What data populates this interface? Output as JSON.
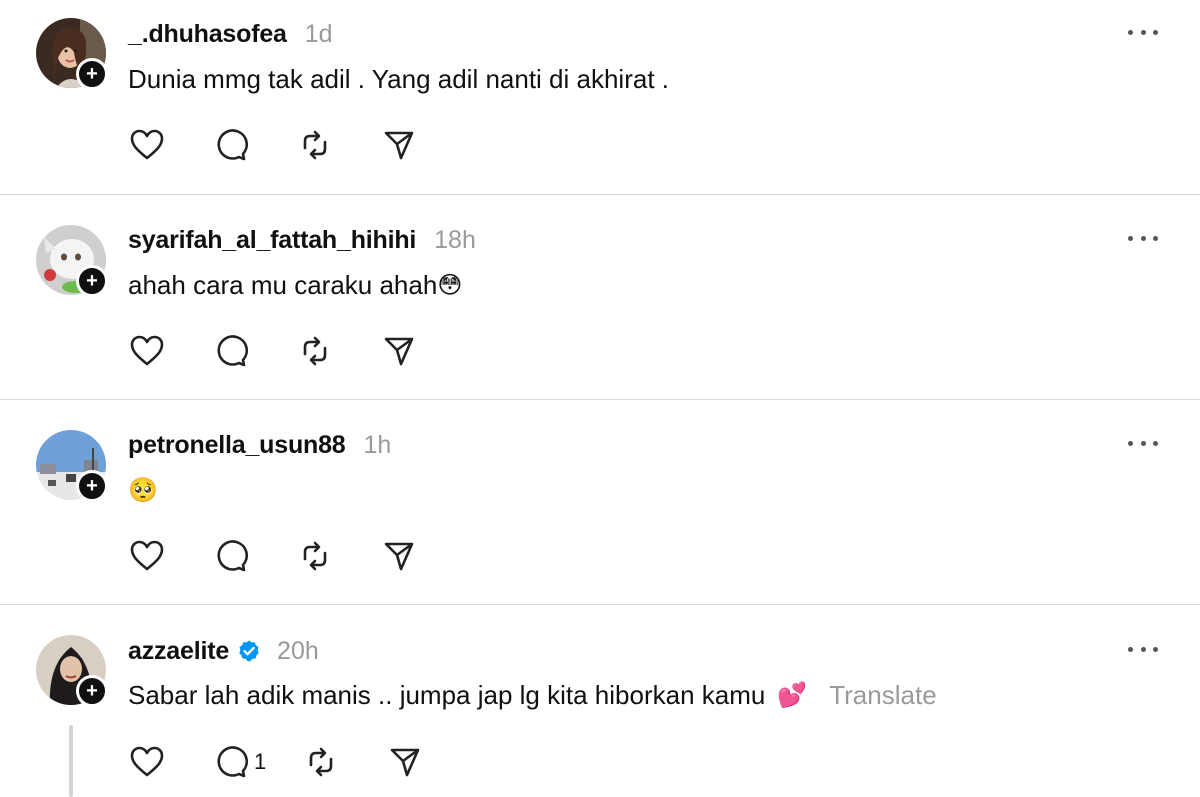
{
  "posts": [
    {
      "username": "_.dhuhasofea",
      "time": "1d",
      "text": "Dunia mmg tak adil . Yang adil nanti di akhirat .",
      "emoji": "",
      "translate": "",
      "verified": false,
      "reply_count": ""
    },
    {
      "username": "syarifah_al_fattah_hihihi",
      "time": "18h",
      "text": "ahah cara mu caraku ahah",
      "emoji": "😳",
      "translate": "",
      "verified": false,
      "reply_count": ""
    },
    {
      "username": "petronella_usun88",
      "time": "1h",
      "text": "",
      "emoji": "🥺",
      "translate": "",
      "verified": false,
      "reply_count": ""
    },
    {
      "username": "azzaelite",
      "time": "20h",
      "text": "Sabar lah adik manis .. jumpa jap lg kita hiborkan kamu",
      "emoji": "💕",
      "translate": "Translate",
      "verified": true,
      "reply_count": "1"
    }
  ],
  "icons": {
    "like": "heart-icon",
    "reply": "comment-icon",
    "repost": "repost-icon",
    "share": "send-icon",
    "more": "more-icon",
    "follow": "plus-icon",
    "verified": "verified-badge-icon"
  },
  "colors": {
    "text": "#101010",
    "muted": "#9a9a9a",
    "verified": "#0095f6",
    "divider": "#d9d9d9"
  }
}
